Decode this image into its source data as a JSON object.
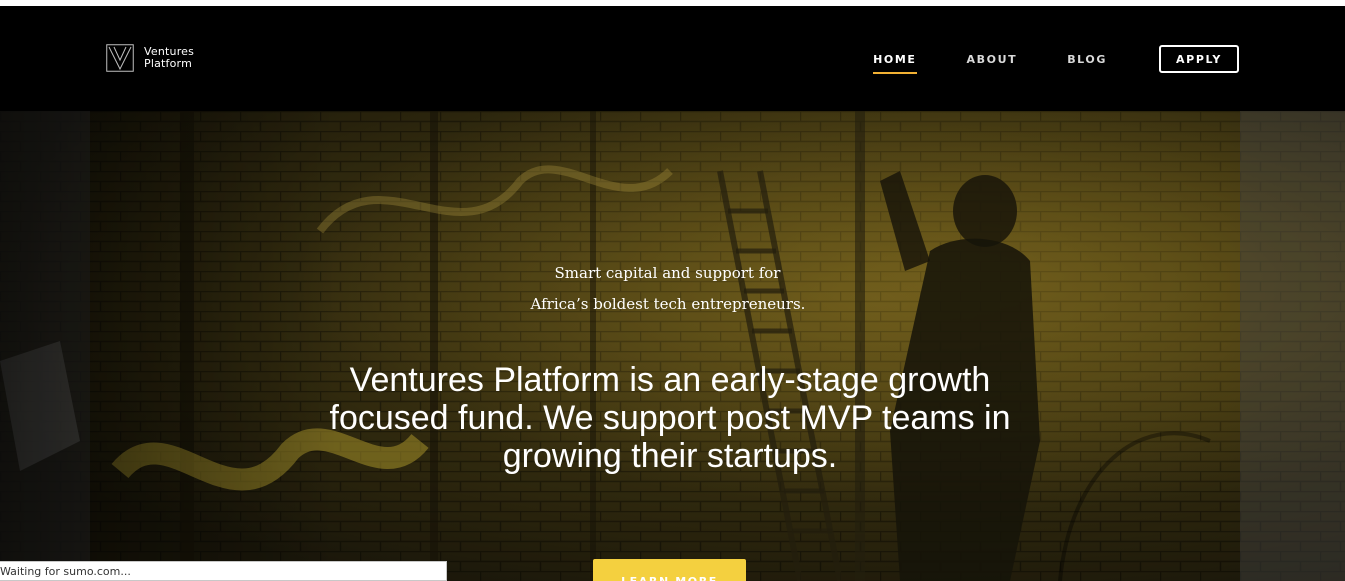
{
  "header": {
    "brand_line1": "Ventures",
    "brand_line2": "Platform",
    "logo_icon": "ventures-platform-v-logo",
    "nav": [
      {
        "label": "HOME",
        "active": true
      },
      {
        "label": "ABOUT",
        "active": false
      },
      {
        "label": "BLOG",
        "active": false
      }
    ],
    "apply_label": "APPLY"
  },
  "hero": {
    "tagline_line1": "Smart capital and support for",
    "tagline_line2": "Africa’s boldest tech entrepreneurs.",
    "headline": "Ventures Platform is an early-stage growth focused fund. We support post MVP teams in growing their startups.",
    "cta_label": "LEARN MORE"
  },
  "browser_status": {
    "text": "Waiting for sumo.com..."
  },
  "colors": {
    "header_bg": "#000000",
    "nav_active_underline": "#f2b134",
    "cta_bg": "#f4d03f",
    "hero_tint": "#6b5a1c"
  }
}
